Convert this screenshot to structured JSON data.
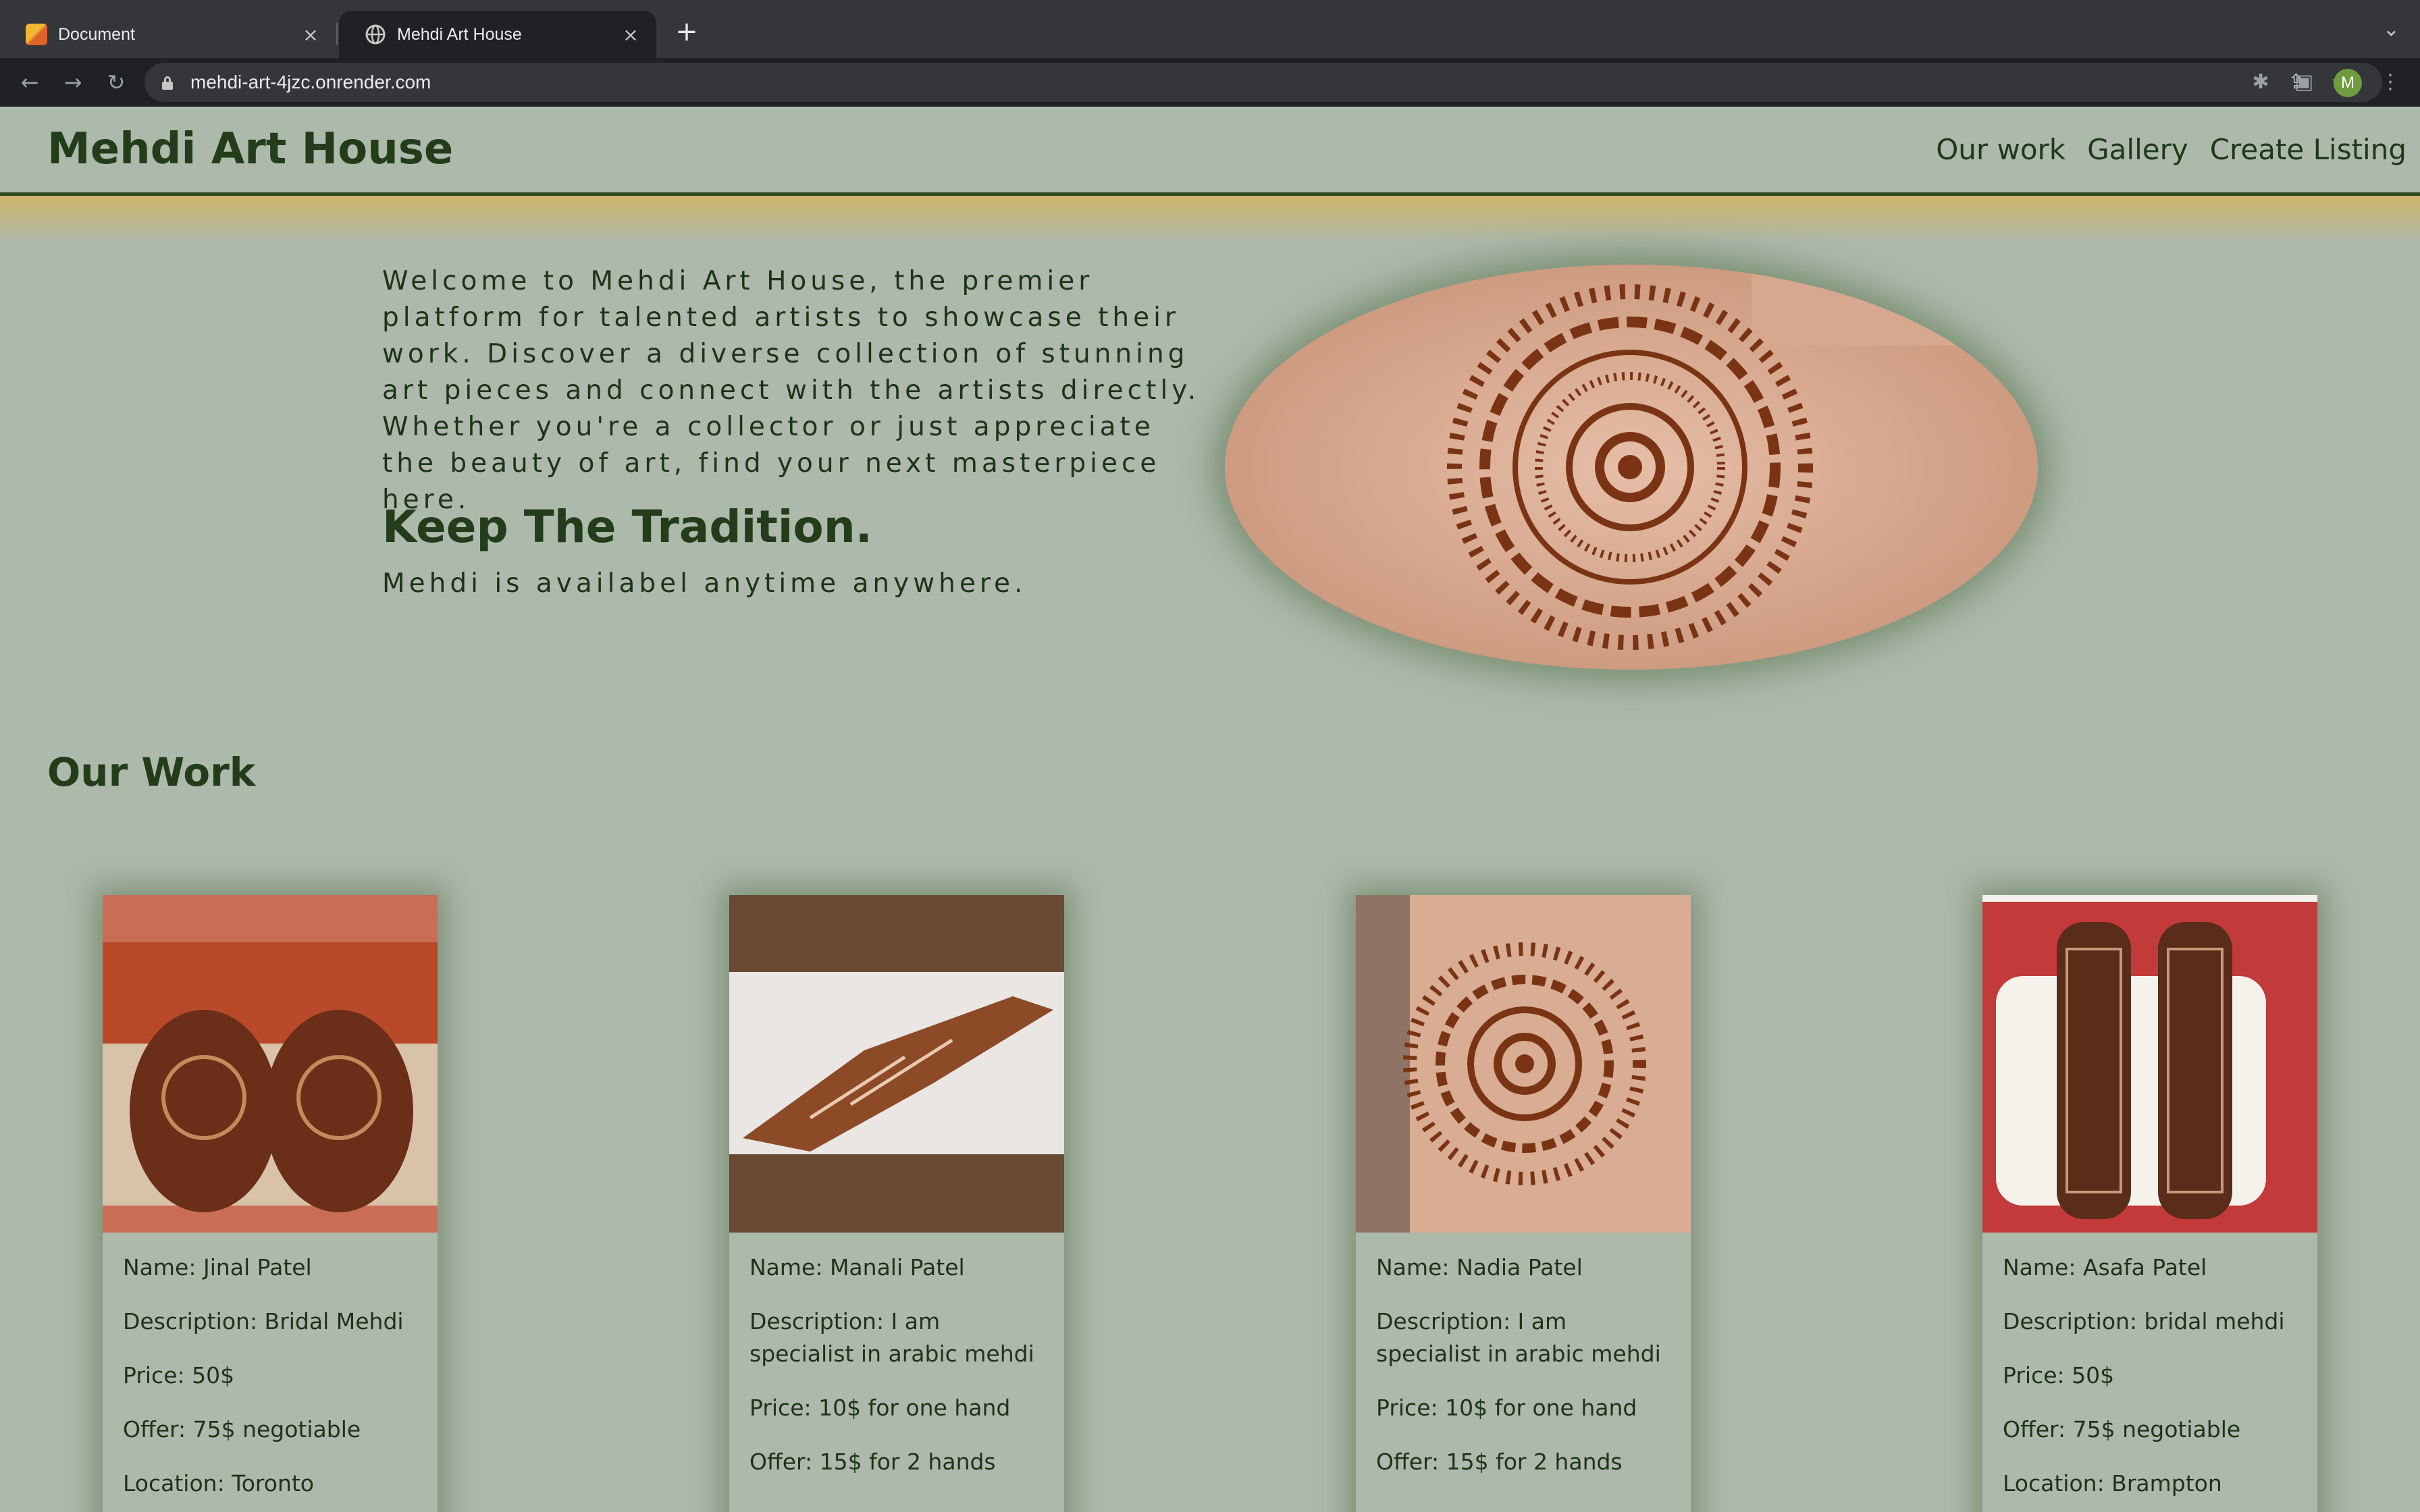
{
  "browser": {
    "tabs": [
      {
        "title": "Document",
        "active": false
      },
      {
        "title": "Mehdi Art House",
        "active": true
      }
    ],
    "url": "mehdi-art-4jzc.onrender.com",
    "profile_initial": "M"
  },
  "site": {
    "brand": "Mehdi Art House",
    "nav": [
      "Our work",
      "Gallery",
      "Create Listing"
    ],
    "intro": "Welcome to Mehdi Art House, the premier platform for talented artists to showcase their work. Discover a diverse collection of stunning art pieces and connect with the artists directly. Whether you're a collector or just appreciate the beauty of art, find your next masterpiece here.",
    "tagline": "Keep The Tradition.",
    "subline": "Mehdi is availabel anytime anywhere.",
    "section_title": "Our Work"
  },
  "cards": [
    {
      "name": "Name: Jinal Patel",
      "description": "Description: Bridal Mehdi",
      "price": "Price: 50$",
      "offer": "Offer: 75$ negotiable",
      "location": "Location: Toronto",
      "image_bg": "#c96d57"
    },
    {
      "name": "Name: Manali Patel",
      "description": "Description: I am specialist in arabic mehdi",
      "price": "Price: 10$ for one hand",
      "offer": "Offer: 15$ for 2 hands",
      "location": "",
      "image_bg": "#6a4a32"
    },
    {
      "name": "Name: Nadia Patel",
      "description": "Description: I am specialist in arabic mehdi",
      "price": "Price: 10$ for one hand",
      "offer": "Offer: 15$ for 2 hands",
      "location": "",
      "image_bg": "#c9a58c"
    },
    {
      "name": "Name: Asafa Patel",
      "description": "Description: bridal mehdi",
      "price": "Price: 50$",
      "offer": "Offer: 75$ negotiable",
      "location": "Location: Brampton",
      "image_bg": "#f4f1ec"
    }
  ],
  "colors": {
    "page_bg": "#adb9ab",
    "brand_green": "#233d1b",
    "header_border": "#2b4a1f",
    "henna": "#7a3414"
  }
}
